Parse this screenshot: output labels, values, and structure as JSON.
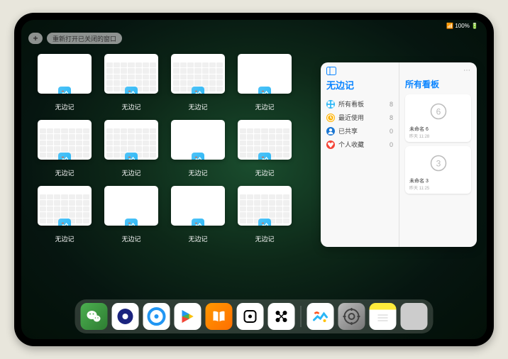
{
  "status": {
    "time": "",
    "signal": "📶 100% 🔋"
  },
  "topbar": {
    "plus": "+",
    "reopen": "重新打开已关闭的窗口"
  },
  "thumbs": [
    {
      "type": "blank",
      "label": "无边记"
    },
    {
      "type": "cal",
      "label": "无边记"
    },
    {
      "type": "cal",
      "label": "无边记"
    },
    {
      "type": "blank",
      "label": "无边记"
    },
    {
      "type": "cal",
      "label": "无边记"
    },
    {
      "type": "cal",
      "label": "无边记"
    },
    {
      "type": "blank",
      "label": "无边记"
    },
    {
      "type": "cal",
      "label": "无边记"
    },
    {
      "type": "cal",
      "label": "无边记"
    },
    {
      "type": "blank",
      "label": "无边记"
    },
    {
      "type": "blank",
      "label": "无边记"
    },
    {
      "type": "cal",
      "label": "无边记"
    }
  ],
  "panel": {
    "title": "无边记",
    "items": [
      {
        "icon": "grid",
        "color": "#29b6f6",
        "label": "所有看板",
        "count": "8"
      },
      {
        "icon": "clock",
        "color": "#ffb300",
        "label": "最近使用",
        "count": "8"
      },
      {
        "icon": "person",
        "color": "#1976d2",
        "label": "已共享",
        "count": "0"
      },
      {
        "icon": "heart",
        "color": "#f44336",
        "label": "个人收藏",
        "count": "0"
      }
    ],
    "right_title": "所有看板",
    "boards": [
      {
        "num": "6",
        "label": "未命名 6",
        "sub": "昨天 11:28"
      },
      {
        "num": "3",
        "label": "未命名 3",
        "sub": "昨天 11:25"
      }
    ]
  },
  "dock": {
    "icons": [
      "wechat",
      "browser1",
      "browser2",
      "play",
      "books",
      "dice",
      "connect",
      "freeform",
      "settings",
      "notes",
      "multi"
    ]
  }
}
